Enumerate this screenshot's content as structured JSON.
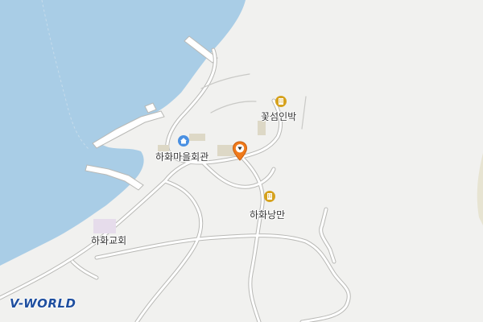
{
  "map": {
    "labels": {
      "village_hall": "하화마을회관",
      "guesthouse": "꽃섬인박",
      "nangman": "하화낭만",
      "church": "하화교회"
    },
    "icons": {
      "village_hall": "home-icon",
      "guesthouse": "building-icon",
      "nangman": "building-icon",
      "marker": "location-pin-icon"
    },
    "colors": {
      "sea": "#a9cde6",
      "land": "#f1f1ef",
      "road": "#ffffff",
      "road_edge": "#b9b9b6",
      "home_icon": "#4a90e2",
      "building_icon": "#d6a21e",
      "marker": "#f07a1a"
    }
  },
  "brand": {
    "logo_text": "V-WORLD"
  }
}
